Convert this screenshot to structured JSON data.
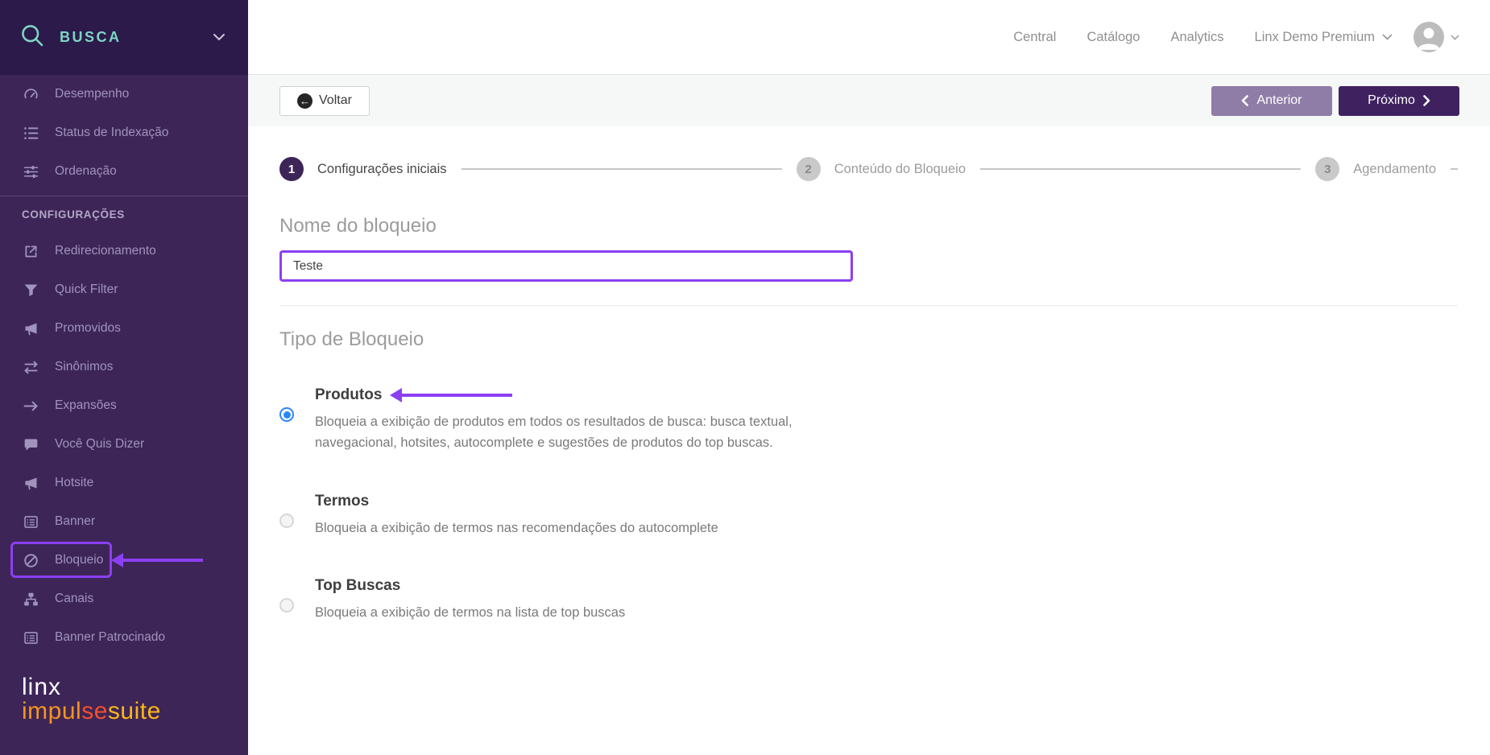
{
  "colors": {
    "accent_annotation": "#8c3ff2",
    "sidebar_bg": "#3d2558",
    "sidebar_header_bg": "#2c1a4b",
    "brand_teal": "#7ed6c3",
    "primary_button": "#3f2160",
    "secondary_button": "#8f7da8",
    "radio_selected": "#2b87f5"
  },
  "sidebar": {
    "product": "BUSCA",
    "product_icon": "search-icon",
    "section": "CONFIGURAÇÕES",
    "items": [
      {
        "label": "Desempenho",
        "icon": "gauge-icon"
      },
      {
        "label": "Status de Indexação",
        "icon": "list-icon"
      },
      {
        "label": "Ordenação",
        "icon": "sliders-icon"
      },
      {
        "label": "Redirecionamento",
        "icon": "external-link-icon"
      },
      {
        "label": "Quick Filter",
        "icon": "filter-icon"
      },
      {
        "label": "Promovidos",
        "icon": "megaphone-icon"
      },
      {
        "label": "Sinônimos",
        "icon": "swap-arrows-icon"
      },
      {
        "label": "Expansões",
        "icon": "arrow-right-icon"
      },
      {
        "label": "Você Quis Dizer",
        "icon": "chat-bubble-icon"
      },
      {
        "label": "Hotsite",
        "icon": "megaphone-icon"
      },
      {
        "label": "Banner",
        "icon": "banner-icon"
      },
      {
        "label": "Bloqueio",
        "icon": "ban-icon"
      },
      {
        "label": "Canais",
        "icon": "sitemap-icon"
      },
      {
        "label": "Banner Patrocinado",
        "icon": "banner-icon"
      }
    ],
    "logo": {
      "line1": "linx",
      "part1": "impul",
      "part2": "se",
      "part3": "suite"
    }
  },
  "topnav": {
    "items": [
      {
        "label": "Central"
      },
      {
        "label": "Catálogo"
      },
      {
        "label": "Analytics"
      }
    ],
    "account": "Linx Demo Premium",
    "avatar_icon": "user-avatar-icon"
  },
  "toolbar": {
    "back_label": "Voltar",
    "back_icon": "circle-arrow-left-icon",
    "prev_label": "Anterior",
    "prev_icon": "chevron-left-icon",
    "next_label": "Próximo",
    "next_icon": "chevron-right-icon"
  },
  "stepper": {
    "steps": [
      {
        "number": "1",
        "label": "Configurações iniciais",
        "active": true
      },
      {
        "number": "2",
        "label": "Conteúdo do Bloqueio",
        "active": false
      },
      {
        "number": "3",
        "label": "Agendamento",
        "active": false
      }
    ]
  },
  "content": {
    "name_heading": "Nome do bloqueio",
    "name_value": "Teste",
    "type_heading": "Tipo de Bloqueio",
    "options": [
      {
        "title": "Produtos",
        "selected": true,
        "description": "Bloqueia a exibição de produtos em todos os resultados de busca: busca textual, navegacional, hotsites, autocomplete e sugestões de produtos do top buscas."
      },
      {
        "title": "Termos",
        "selected": false,
        "description": "Bloqueia a exibição de termos nas recomendações do autocomplete"
      },
      {
        "title": "Top Buscas",
        "selected": false,
        "description": "Bloqueia a exibição de termos na lista de top buscas"
      }
    ]
  },
  "annotations": {
    "highlighted_sidebar_item": "Bloqueio",
    "highlighted_input": "Nome do bloqueio",
    "highlighted_option": "Produtos"
  }
}
